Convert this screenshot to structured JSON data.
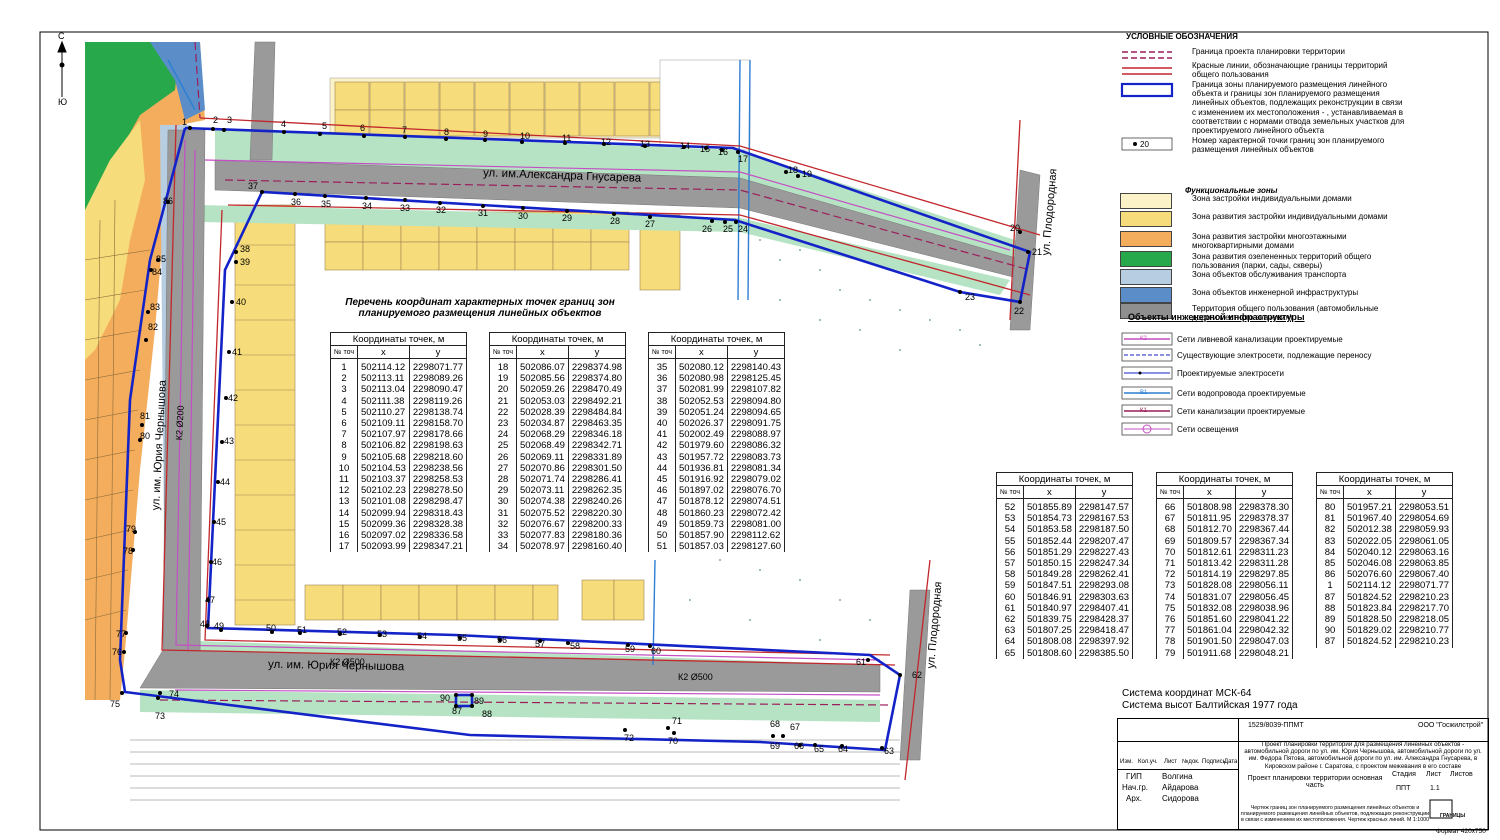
{
  "compass": {
    "top": "С",
    "bottom": "Ю"
  },
  "streets": [
    {
      "key": "gnusareva",
      "label": "ул. им.Александра Гнусарева"
    },
    {
      "key": "chernyshova_south",
      "label": "ул. им. Юрия Чернышова"
    },
    {
      "key": "chernyshova_west",
      "label": "ул. им. Юрия Чернышова"
    },
    {
      "key": "plodorodnaya_north",
      "label": "ул. Плодородная"
    },
    {
      "key": "plodorodnaya_south",
      "label": "ул. Плодородная"
    }
  ],
  "network_labels": {
    "k2_west": "К2 Ø200",
    "k2_south1": "К2 Ø500",
    "k2_south2": "К2 Ø500"
  },
  "list_title": "Перечень координат характерных точек границ зон планируемого размещения линейных объектов",
  "table_headers": {
    "caption": "Координаты точек, м",
    "num": "№ точ",
    "x": "x",
    "y": "y"
  },
  "tables": [
    {
      "rows": [
        [
          "1",
          "502114.12",
          "2298071.77"
        ],
        [
          "2",
          "502113.11",
          "2298089.26"
        ],
        [
          "3",
          "502113.04",
          "2298090.47"
        ],
        [
          "4",
          "502111.38",
          "2298119.26"
        ],
        [
          "5",
          "502110.27",
          "2298138.74"
        ],
        [
          "6",
          "502109.11",
          "2298158.70"
        ],
        [
          "7",
          "502107.97",
          "2298178.66"
        ],
        [
          "8",
          "502106.82",
          "2298198.63"
        ],
        [
          "9",
          "502105.68",
          "2298218.60"
        ],
        [
          "10",
          "502104.53",
          "2298238.56"
        ],
        [
          "11",
          "502103.37",
          "2298258.53"
        ],
        [
          "12",
          "502102.23",
          "2298278.50"
        ],
        [
          "13",
          "502101.08",
          "2298298.47"
        ],
        [
          "14",
          "502099.94",
          "2298318.43"
        ],
        [
          "15",
          "502099.36",
          "2298328.38"
        ],
        [
          "16",
          "502097.02",
          "2298336.58"
        ],
        [
          "17",
          "502093.99",
          "2298347.21"
        ]
      ]
    },
    {
      "rows": [
        [
          "18",
          "502086.07",
          "2298374.98"
        ],
        [
          "19",
          "502085.56",
          "2298374.80"
        ],
        [
          "20",
          "502059.26",
          "2298470.49"
        ],
        [
          "21",
          "502053.03",
          "2298492.21"
        ],
        [
          "22",
          "502028.39",
          "2298484.84"
        ],
        [
          "23",
          "502034.87",
          "2298463.35"
        ],
        [
          "24",
          "502068.29",
          "2298346.18"
        ],
        [
          "25",
          "502068.49",
          "2298342.71"
        ],
        [
          "26",
          "502069.11",
          "2298331.89"
        ],
        [
          "27",
          "502070.86",
          "2298301.50"
        ],
        [
          "28",
          "502071.74",
          "2298286.41"
        ],
        [
          "29",
          "502073.11",
          "2298262.35"
        ],
        [
          "30",
          "502074.38",
          "2298240.26"
        ],
        [
          "31",
          "502075.52",
          "2298220.30"
        ],
        [
          "32",
          "502076.67",
          "2298200.33"
        ],
        [
          "33",
          "502077.83",
          "2298180.36"
        ],
        [
          "34",
          "502078.97",
          "2298160.40"
        ]
      ]
    },
    {
      "rows": [
        [
          "35",
          "502080.12",
          "2298140.43"
        ],
        [
          "36",
          "502080.98",
          "2298125.45"
        ],
        [
          "37",
          "502081.99",
          "2298107.82"
        ],
        [
          "38",
          "502052.53",
          "2298094.80"
        ],
        [
          "39",
          "502051.24",
          "2298094.65"
        ],
        [
          "40",
          "502026.37",
          "2298091.75"
        ],
        [
          "41",
          "502002.49",
          "2298088.97"
        ],
        [
          "42",
          "501979.60",
          "2298086.32"
        ],
        [
          "43",
          "501957.72",
          "2298083.73"
        ],
        [
          "44",
          "501936.81",
          "2298081.34"
        ],
        [
          "45",
          "501916.92",
          "2298079.02"
        ],
        [
          "46",
          "501897.02",
          "2298076.70"
        ],
        [
          "47",
          "501878.12",
          "2298074.51"
        ],
        [
          "48",
          "501860.23",
          "2298072.42"
        ],
        [
          "49",
          "501859.73",
          "2298081.00"
        ],
        [
          "50",
          "501857.90",
          "2298112.62"
        ],
        [
          "51",
          "501857.03",
          "2298127.60"
        ]
      ]
    },
    {
      "rows": [
        [
          "52",
          "501855.89",
          "2298147.57"
        ],
        [
          "53",
          "501854.73",
          "2298167.53"
        ],
        [
          "54",
          "501853.58",
          "2298187.50"
        ],
        [
          "55",
          "501852.44",
          "2298207.47"
        ],
        [
          "56",
          "501851.29",
          "2298227.43"
        ],
        [
          "57",
          "501850.15",
          "2298247.34"
        ],
        [
          "58",
          "501849.28",
          "2298262.41"
        ],
        [
          "59",
          "501847.51",
          "2298293.08"
        ],
        [
          "60",
          "501846.91",
          "2298303.63"
        ],
        [
          "61",
          "501840.97",
          "2298407.41"
        ],
        [
          "62",
          "501839.75",
          "2298428.37"
        ],
        [
          "63",
          "501807.25",
          "2298418.47"
        ],
        [
          "64",
          "501808.08",
          "2298397.92"
        ],
        [
          "65",
          "501808.60",
          "2298385.50"
        ]
      ]
    },
    {
      "rows": [
        [
          "66",
          "501808.98",
          "2298378.30"
        ],
        [
          "67",
          "501811.95",
          "2298378.37"
        ],
        [
          "68",
          "501812.70",
          "2298367.44"
        ],
        [
          "69",
          "501809.57",
          "2298367.34"
        ],
        [
          "70",
          "501812.61",
          "2298311.23"
        ],
        [
          "71",
          "501813.42",
          "2298311.28"
        ],
        [
          "72",
          "501814.19",
          "2298297.85"
        ],
        [
          "73",
          "501828.08",
          "2298056.11"
        ],
        [
          "74",
          "501831.07",
          "2298056.45"
        ],
        [
          "75",
          "501832.08",
          "2298038.96"
        ],
        [
          "76",
          "501851.60",
          "2298041.22"
        ],
        [
          "77",
          "501861.04",
          "2298042.32"
        ],
        [
          "78",
          "501901.50",
          "2298047.03"
        ],
        [
          "79",
          "501911.68",
          "2298048.21"
        ]
      ]
    },
    {
      "rows": [
        [
          "80",
          "501957.21",
          "2298053.51"
        ],
        [
          "81",
          "501967.40",
          "2298054.69"
        ],
        [
          "82",
          "502012.38",
          "2298059.93"
        ],
        [
          "83",
          "502022.05",
          "2298061.05"
        ],
        [
          "84",
          "502040.12",
          "2298063.16"
        ],
        [
          "85",
          "502046.08",
          "2298063.85"
        ],
        [
          "86",
          "502076.60",
          "2298067.40"
        ],
        [
          "1",
          "502114.12",
          "2298071.77"
        ],
        [
          "",
          "",
          ""
        ],
        [
          "87",
          "501824.52",
          "2298210.23"
        ],
        [
          "88",
          "501823.84",
          "2298217.70"
        ],
        [
          "89",
          "501828.50",
          "2298218.05"
        ],
        [
          "90",
          "501829.02",
          "2298210.77"
        ],
        [
          "87",
          "501824.52",
          "2298210.23"
        ]
      ]
    }
  ],
  "legend": {
    "title": "УСЛОВНЫЕ ОБОЗНАЧЕНИЯ",
    "items": [
      {
        "text": "Граница проекта планировки территории"
      },
      {
        "text": "Красные линии, обозначающие границы территорий общего пользования"
      },
      {
        "text": "Граница зоны планируемого размещения линейного объекта и границы зон планируемого размещения линейных объектов, подлежащих реконструкции в связи с изменением их местоположения - , устанавливаемая в соответствии с нормами отвода земельных участков для проектируемого линейного объекта"
      },
      {
        "text": "Номер характерной точки границ зон планируемого размещения линейных объектов",
        "symbol": "20"
      }
    ],
    "functional_title": "Функциональные зоны",
    "zones": [
      {
        "text": "Зона застройки индивидуальными домами",
        "color": "#fbf2c8"
      },
      {
        "text": "Зона развития застройки индивидуальными домами",
        "color": "#f6dc7a"
      },
      {
        "text": "Зона развития застройки многоэтажными многоквартирными домами",
        "color": "#f3ad5c"
      },
      {
        "text": "Зона развития озелененных территорий общего пользования (парки, сады, скверы)",
        "color": "#27a84a"
      },
      {
        "text": "Зона объектов обслуживания транспорта",
        "color": "#b7cde2"
      },
      {
        "text": "Зона объектов инженерной инфраструктуры",
        "color": "#5b8ec9"
      },
      {
        "text": "Территория общего пользования (автомобильные дороги местного значения)",
        "color": "#8f8f8f"
      }
    ],
    "infra_title": "Объекты инженерной инфраструктуры",
    "infra": [
      {
        "text": "Сети ливневой канализации проектируемые",
        "code": "К2"
      },
      {
        "text": "Существующие электросети, подлежащие переносу"
      },
      {
        "text": "Проектируемые электросети"
      },
      {
        "text": "Сети водопровода проектируемые",
        "code": "В1"
      },
      {
        "text": "Сети канализации проектируемые",
        "code": "К1"
      },
      {
        "text": "Сети освещения"
      }
    ]
  },
  "coord_system": {
    "line1": "Система координат МСК-64",
    "line2": "Система высот Балтийская 1977 года"
  },
  "stamp": {
    "code": "1529/8039-ППМТ",
    "org": "ООО \"Госжилстрой\"",
    "project_title": "Проект планировки территории для размещения линейных объектов - автомобильной дороги по ул. им. Юрия Чернышова, автомобильной дороги по ул. им. Федора Пятова, автомобильной дороги по ул. им. Александра Гнусарева, в Кировском районе г. Саратова, с проектом межевания в его составе",
    "cols": [
      "Изм.",
      "Кол.уч.",
      "Лист",
      "№док.",
      "Подпись",
      "Дата"
    ],
    "people": [
      [
        "ГИП",
        "Волгина"
      ],
      [
        "Нач.гр.",
        "Айдарова"
      ],
      [
        "Арх.",
        "Сидорова"
      ]
    ],
    "part": "Проект планировки территории основная часть",
    "stage_label": "Стадия",
    "sheet_label": "Лист",
    "sheets_label": "Листов",
    "stage": "ППТ",
    "sheet": "1.1",
    "sheets": "",
    "drawing": "Чертеж границ зон планируемого размещения линейных объектов и планируемого размещения линейных объектов, подлежащих реконструкции в связи с изменением их местоположения. Чертеж красных линий. М 1:1000",
    "logo": "ГРАНИЦЫ",
    "format": "Формат 420х750"
  },
  "points": {
    "n1": "1",
    "n2": "2",
    "n3": "3",
    "n4": "4",
    "n5": "5",
    "n6": "6",
    "n7": "7",
    "n8": "8",
    "n9": "9",
    "n10": "10",
    "n11": "11",
    "n12": "12",
    "n13": "13",
    "n14": "14",
    "n15": "15",
    "n16": "16",
    "n17": "17",
    "n18": "18",
    "n19": "19",
    "n20": "20",
    "n21": "21",
    "n22": "22",
    "n23": "23",
    "n24": "24",
    "n25": "25",
    "n26": "26",
    "n27": "27",
    "n28": "28",
    "n29": "29",
    "n30": "30",
    "n31": "31",
    "n32": "32",
    "n33": "33",
    "n34": "34",
    "n35": "35",
    "n36": "36",
    "n37": "37",
    "n38": "38",
    "n39": "39",
    "n40": "40",
    "n41": "41",
    "n42": "42",
    "n43": "43",
    "n44": "44",
    "n45": "45",
    "n46": "46",
    "n47": "47",
    "n48": "48",
    "n49": "49",
    "n50": "50",
    "n51": "51",
    "n52": "52",
    "n53": "53",
    "n54": "54",
    "n55": "55",
    "n56": "56",
    "n57": "57",
    "n58": "58",
    "n59": "59",
    "n60": "60",
    "n61": "61",
    "n62": "62",
    "n63": "63",
    "n64": "64",
    "n65": "65",
    "n66": "66",
    "n67": "67",
    "n68": "68",
    "n69": "69",
    "n70": "70",
    "n71": "71",
    "n72": "72",
    "n73": "73",
    "n74": "74",
    "n75": "75",
    "n76": "76",
    "n77": "77",
    "n78": "78",
    "n79": "79",
    "n80": "80",
    "n81": "81",
    "n82": "82",
    "n83": "83",
    "n84": "84",
    "n85": "85",
    "n86": "86",
    "n87": "87",
    "n88": "88",
    "n89": "89",
    "n90": "90"
  }
}
